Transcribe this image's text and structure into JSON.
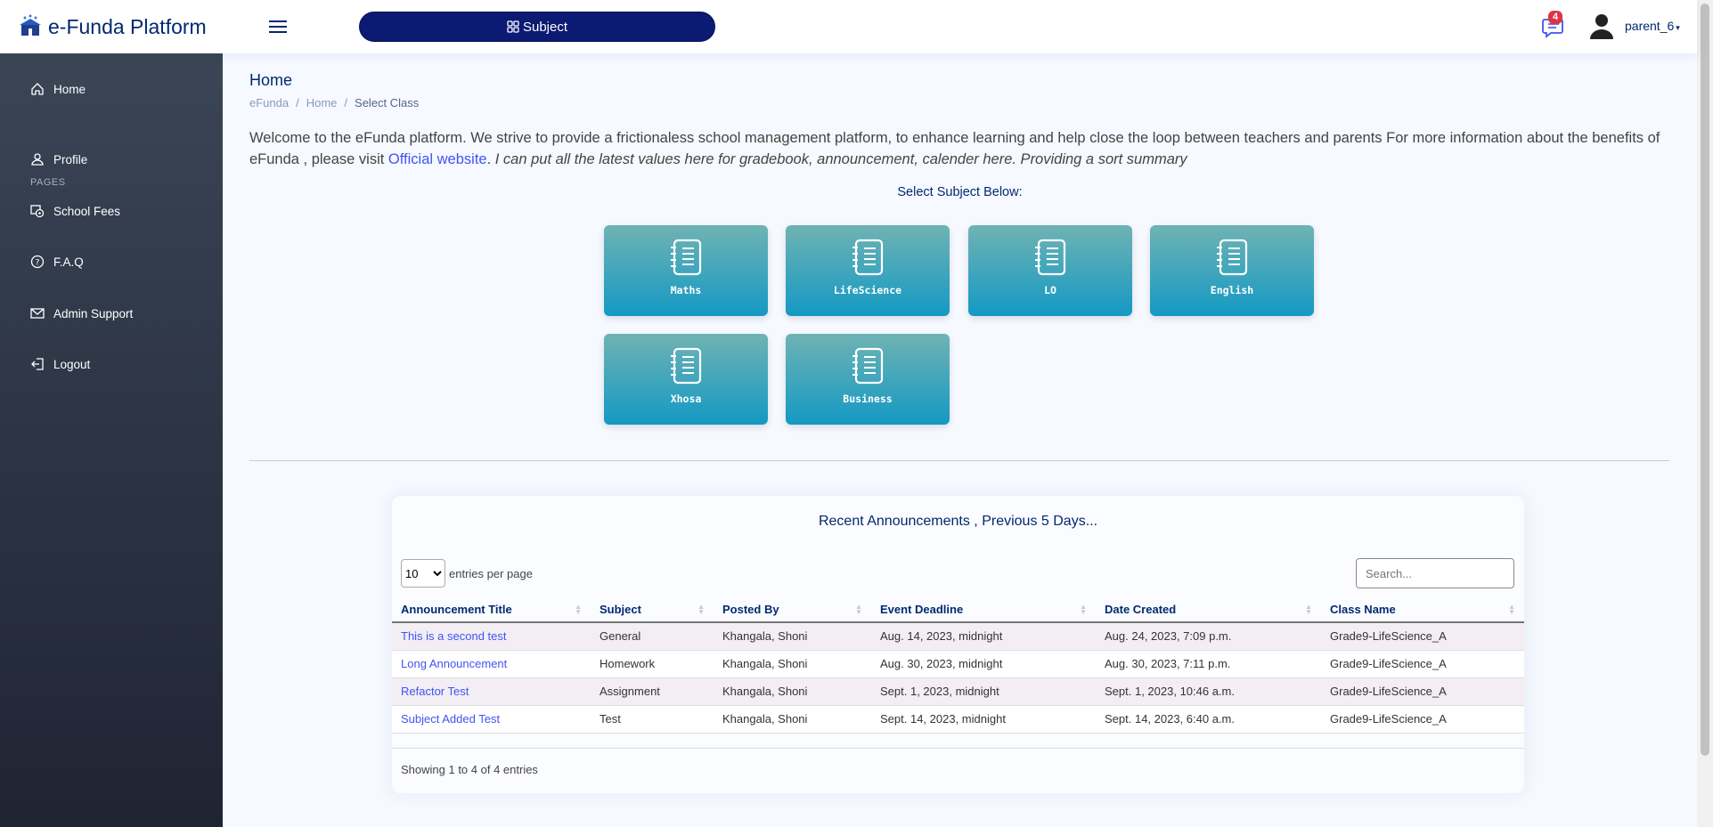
{
  "header": {
    "logo_text": "e-Funda Platform",
    "subject_button_label": "Subject",
    "notification_count": "4",
    "user_name": "parent_6"
  },
  "sidebar": {
    "items": [
      {
        "label": "Home",
        "icon": "house-icon"
      },
      {
        "label": "Profile",
        "icon": "person-icon"
      },
      {
        "label": "School Fees",
        "icon": "cash-icon"
      },
      {
        "label": "F.A.Q",
        "icon": "question-circle-icon"
      },
      {
        "label": "Admin Support",
        "icon": "envelope-icon"
      },
      {
        "label": "Logout",
        "icon": "logout-icon"
      }
    ],
    "pages_heading": "PAGES"
  },
  "main": {
    "page_title": "Home",
    "breadcrumb": [
      "eFunda",
      "Home",
      "Select Class"
    ],
    "welcome_text": "Welcome to the eFunda platform. We strive to provide a frictionaless school management platform, to enhance learning and help close the loop between teachers and parents For more information about the benefits of eFunda , please visit ",
    "welcome_link": "Official website",
    "welcome_period": ". ",
    "welcome_italic": "I can put all the latest values here for gradebook, announcement, calender here. Providing a sort summary",
    "select_label": "Select Subject Below:",
    "subjects": [
      "Maths",
      "LifeScience",
      "LO",
      "English",
      "Xhosa",
      "Business"
    ]
  },
  "announcements": {
    "title": "Recent Announcements , Previous 5 Days...",
    "page_size": "10",
    "entries_label": "entries per page",
    "search_placeholder": "Search...",
    "columns": [
      "Announcement Title",
      "Subject",
      "Posted By",
      "Event Deadline",
      "Date Created",
      "Class Name"
    ],
    "rows": [
      [
        "This is a second test",
        "General",
        "Khangala, Shoni",
        "Aug. 14, 2023, midnight",
        "Aug. 24, 2023, 7:09 p.m.",
        "Grade9-LifeScience_A"
      ],
      [
        "Long Announcement",
        "Homework",
        "Khangala, Shoni",
        "Aug. 30, 2023, midnight",
        "Aug. 30, 2023, 7:11 p.m.",
        "Grade9-LifeScience_A"
      ],
      [
        "Refactor Test",
        "Assignment",
        "Khangala, Shoni",
        "Sept. 1, 2023, midnight",
        "Sept. 1, 2023, 10:46 a.m.",
        "Grade9-LifeScience_A"
      ],
      [
        "Subject Added Test",
        "Test",
        "Khangala, Shoni",
        "Sept. 14, 2023, midnight",
        "Sept. 14, 2023, 6:40 a.m.",
        "Grade9-LifeScience_A"
      ]
    ],
    "showing_text": "Showing 1 to 4 of 4 entries"
  },
  "colors": {
    "brand": "#012970",
    "subject_button": "#0b1a73",
    "link": "#4154f1",
    "badge": "#dc3545",
    "card_top": "#6fb3b3",
    "card_bottom": "#1499c4",
    "sidebar_top": "#3a4556",
    "sidebar_bottom": "#1f2433"
  }
}
